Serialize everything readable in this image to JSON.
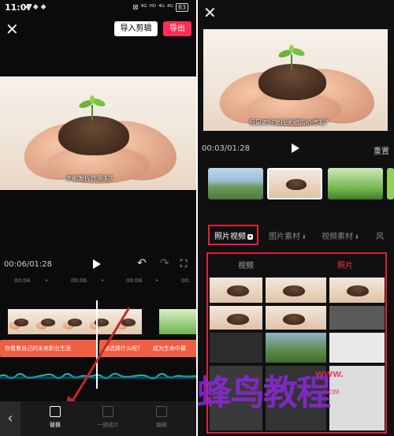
{
  "status_bar": {
    "time": "11:07",
    "notif_icons": "◆ ◆ ◆",
    "signal": "⊠ ⁴ᴳ ᴴᴰ ⁴ᴳ ⁴ᴳ",
    "battery": "83"
  },
  "left": {
    "import_label": "导入剪辑",
    "export_label": "导出",
    "preview_subtitle": "才能发挥作用呢？",
    "timecode": "00:06/01:28",
    "ruler": [
      "00:04",
      "•",
      "00:06",
      "•",
      "00:08",
      "•",
      "00:"
    ],
    "subtitle_chips": [
      "你看着自己的未来职业生涯",
      "该选择什么呢？",
      "成为生命中最"
    ],
    "toolbar": [
      {
        "label": "替换",
        "icon": "replace-icon"
      },
      {
        "label": "一键成片",
        "icon": "film-icon"
      },
      {
        "label": "编辑",
        "icon": "edit-icon"
      }
    ]
  },
  "right": {
    "preview_subtitle": "但是如何发挥天赋的价值呢？",
    "timecode": "00:03/01:28",
    "reset_label": "重置",
    "tabs": [
      "照片视频",
      "图片素材",
      "视频素材",
      "风"
    ],
    "active_tab_badge": "▾",
    "media_tabs": [
      "视频",
      "照片"
    ]
  },
  "watermark": {
    "main": "蜂鸟教程",
    "sub_line1": "WWW.",
    "sub_line2": "...COM"
  },
  "colors": {
    "accent": "#ff2d55",
    "highlight": "#e01e3c",
    "chip": "#f05f43",
    "wave": "#1bb3c8"
  }
}
